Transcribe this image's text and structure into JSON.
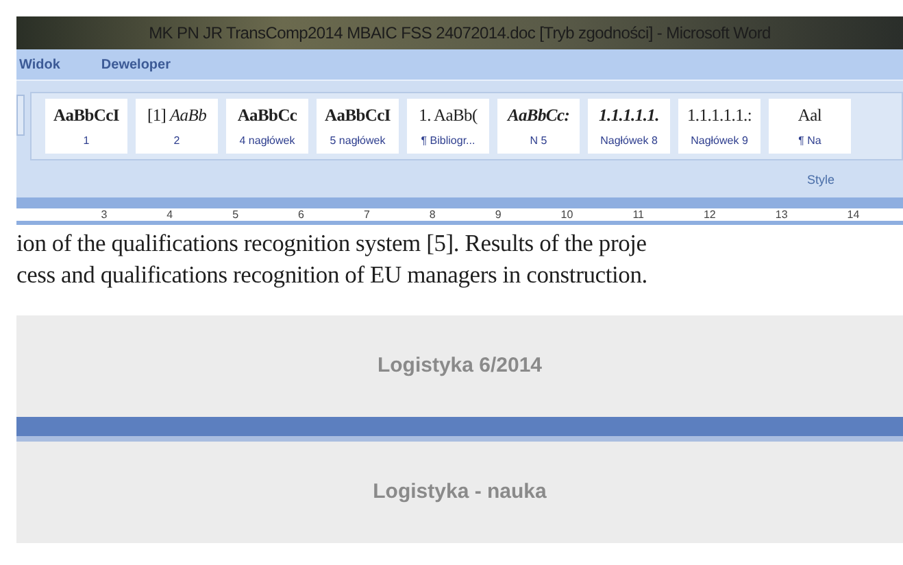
{
  "window": {
    "title": "MK PN JR TransComp2014 MBAIC FSS 24072014.doc [Tryb zgodności] - Microsoft Word"
  },
  "ribbon_tabs": [
    "Widok",
    "Deweloper"
  ],
  "styles": [
    {
      "preview": "AaBbCcI",
      "name": "1",
      "kind": "bold"
    },
    {
      "preview": "[1] *AaBb*",
      "name": "2",
      "kind": "regular"
    },
    {
      "preview": "AaBbCc",
      "name": "4 nagłówek",
      "kind": "bold"
    },
    {
      "preview": "AaBbCcI",
      "name": "5 nagłówek",
      "kind": "bold"
    },
    {
      "preview": "1. AaBb(",
      "name": "¶ Bibliogr...",
      "kind": "regular"
    },
    {
      "preview": "AaBbCc:",
      "name": "N 5",
      "kind": "bolditalic"
    },
    {
      "preview": "1.1.1.1.1.",
      "name": "Nagłówek 8",
      "kind": "italic"
    },
    {
      "preview": "1.1.1.1.1.:",
      "name": "Nagłówek 9",
      "kind": "regular"
    },
    {
      "preview": "Aal",
      "name": "¶ Na",
      "kind": "regular"
    }
  ],
  "group_label": "Style",
  "ruler": [
    "3",
    "4",
    "5",
    "6",
    "7",
    "8",
    "9",
    "10",
    "11",
    "12",
    "13",
    "14"
  ],
  "document_lines": [
    "ion of the qualifications recognition system [5]. Results of the proje",
    "cess and qualifications recognition of EU managers in construction."
  ],
  "footer_bands": [
    "Logistyka 6/2014",
    "Logistyka - nauka"
  ]
}
